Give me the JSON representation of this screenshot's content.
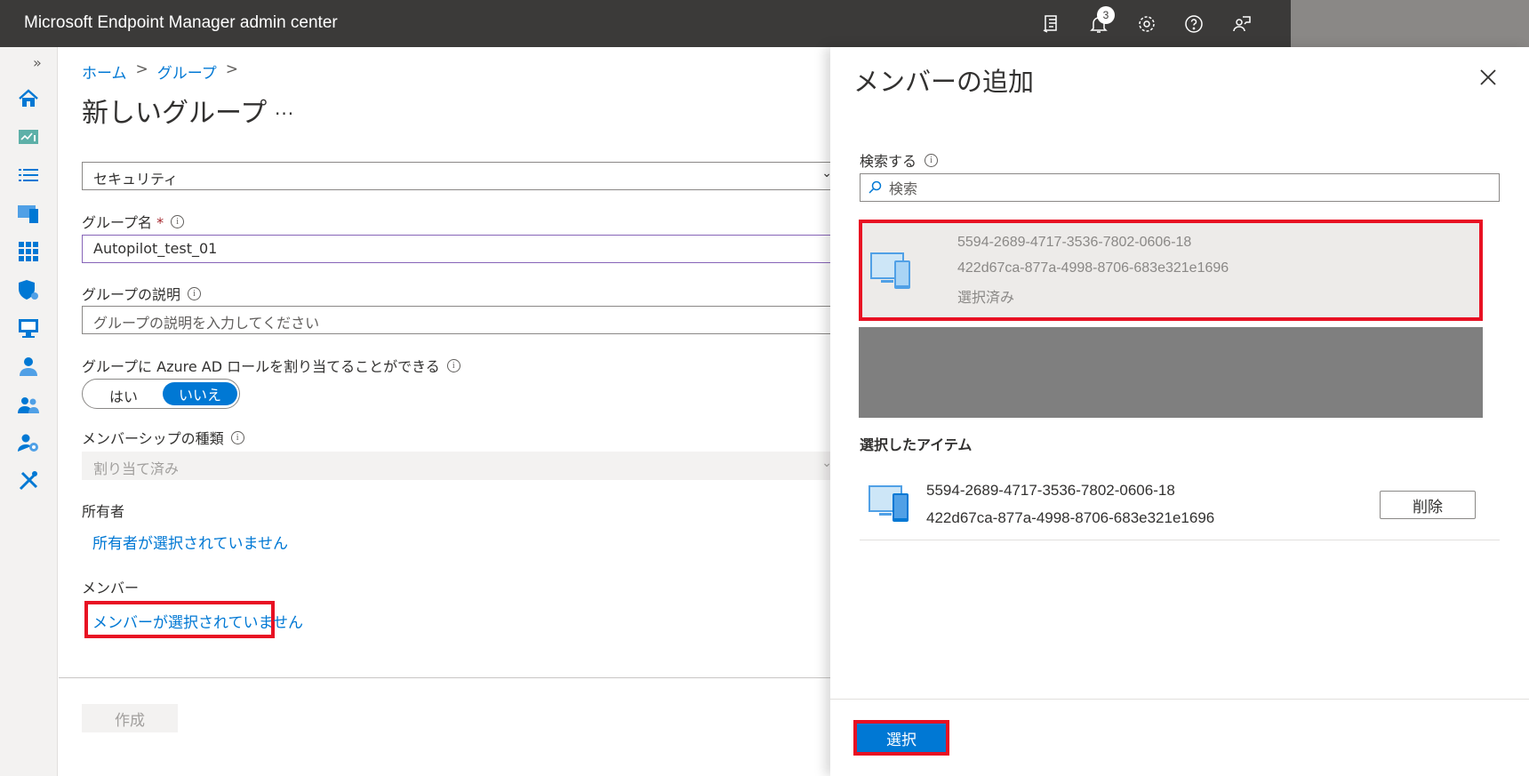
{
  "header": {
    "app_title": "Microsoft Endpoint Manager admin center",
    "notification_count": "3",
    "icons": [
      "feedback-device-icon",
      "bell-icon",
      "gear-icon",
      "help-icon",
      "feedback-person-icon"
    ]
  },
  "nav": {
    "expand": "»",
    "icons": [
      "home-icon",
      "dashboard-icon",
      "all-services-icon",
      "devices-icon",
      "apps-icon",
      "endpoint-security-icon",
      "reports-icon",
      "users-icon",
      "groups-icon",
      "tenant-admin-icon",
      "troubleshooting-icon"
    ]
  },
  "breadcrumb": {
    "home": "ホーム",
    "groups": "グループ",
    "sep": ">"
  },
  "page": {
    "title": "新しいグループ",
    "more": "..."
  },
  "form": {
    "group_type_value": "セキュリティ",
    "group_name_label": "グループ名",
    "group_name_required": "*",
    "group_name_value": "Autopilot_test_01",
    "description_label": "グループの説明",
    "description_placeholder": "グループの説明を入力してください",
    "azure_role_label": "グループに Azure AD ロールを割り当てることができる",
    "toggle_yes": "はい",
    "toggle_no": "いいえ",
    "membership_label": "メンバーシップの種類",
    "membership_value": "割り当て済み",
    "owners_label": "所有者",
    "owners_link": "所有者が選択されていません",
    "members_label": "メンバー",
    "members_link": "メンバーが選択されていません",
    "create_button": "作成",
    "info": "i"
  },
  "panel": {
    "title": "メンバーの追加",
    "search_label": "検索する",
    "search_placeholder": "検索",
    "result": {
      "line1": "5594-2689-4717-3536-7802-0606-18",
      "line2": "422d67ca-877a-4998-8706-683e321e1696",
      "status": "選択済み"
    },
    "selected_heading": "選択したアイテム",
    "selected_item": {
      "line1": "5594-2689-4717-3536-7802-0606-18",
      "line2": "422d67ca-877a-4998-8706-683e321e1696"
    },
    "delete_button": "削除",
    "select_button": "選択"
  },
  "colors": {
    "accent": "#0078d4",
    "highlight": "#e81123",
    "topbar": "#3b3a39"
  }
}
